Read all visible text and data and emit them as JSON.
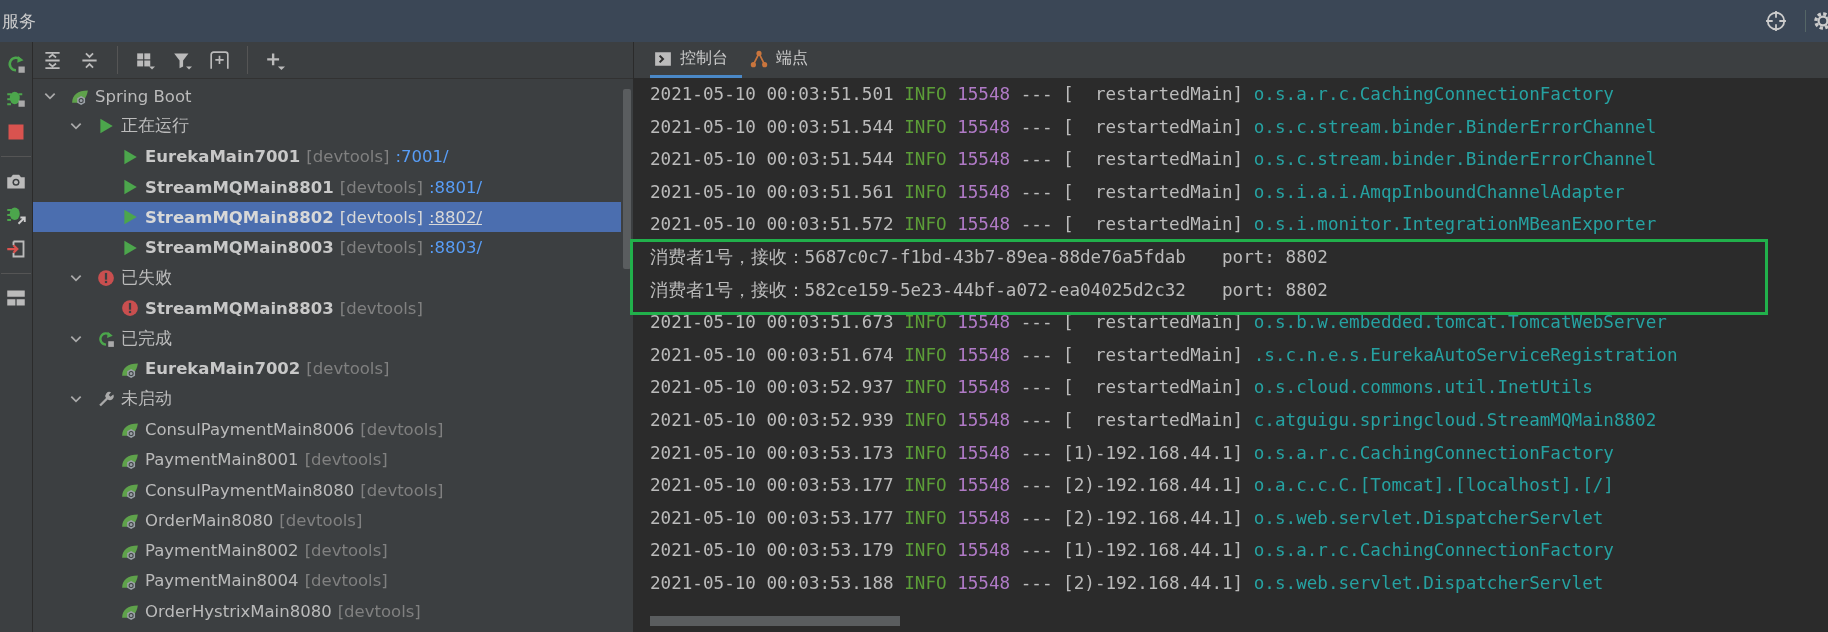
{
  "window": {
    "title": "服务"
  },
  "tree": [
    {
      "label": "Spring Boot",
      "kind": "spring",
      "expanded": true,
      "children": [
        {
          "label": "正在运行",
          "kind": "run",
          "expanded": true,
          "children": [
            {
              "label": "EurekaMain7001",
              "tag": "[devtools]",
              "port": ":7001/",
              "kind": "run",
              "active": true,
              "selected": false
            },
            {
              "label": "StreamMQMain8801",
              "tag": "[devtools]",
              "port": ":8801/",
              "kind": "run",
              "active": true,
              "selected": false
            },
            {
              "label": "StreamMQMain8802",
              "tag": "[devtools]",
              "port": ":8802/",
              "kind": "run",
              "active": true,
              "selected": true
            },
            {
              "label": "StreamMQMain8003",
              "tag": "[devtools]",
              "port": ":8803/",
              "kind": "run",
              "active": true,
              "selected": false
            }
          ]
        },
        {
          "label": "已失败",
          "kind": "error",
          "expanded": true,
          "children": [
            {
              "label": "StreamMQMain8803",
              "tag": "[devtools]",
              "kind": "error",
              "active": true,
              "selected": false
            }
          ]
        },
        {
          "label": "已完成",
          "kind": "rerun",
          "expanded": true,
          "children": [
            {
              "label": "EurekaMain7002",
              "tag": "[devtools]",
              "kind": "spring",
              "active": true,
              "selected": false
            }
          ]
        },
        {
          "label": "未启动",
          "kind": "wrench",
          "expanded": true,
          "children": [
            {
              "label": "ConsulPaymentMain8006",
              "tag": "[devtools]",
              "kind": "spring",
              "active": false,
              "selected": false
            },
            {
              "label": "PaymentMain8001",
              "tag": "[devtools]",
              "kind": "spring",
              "active": false,
              "selected": false
            },
            {
              "label": "ConsulPaymentMain8080",
              "tag": "[devtools]",
              "kind": "spring",
              "active": false,
              "selected": false
            },
            {
              "label": "OrderMain8080",
              "tag": "[devtools]",
              "kind": "spring",
              "active": false,
              "selected": false
            },
            {
              "label": "PaymentMain8002",
              "tag": "[devtools]",
              "kind": "spring",
              "active": false,
              "selected": false
            },
            {
              "label": "PaymentMain8004",
              "tag": "[devtools]",
              "kind": "spring",
              "active": false,
              "selected": false
            },
            {
              "label": "OrderHystrixMain8080",
              "tag": "[devtools]",
              "kind": "spring",
              "active": false,
              "selected": false
            }
          ]
        }
      ]
    }
  ],
  "tabs": [
    {
      "label": "控制台",
      "selected": true
    },
    {
      "label": "端点",
      "selected": false
    }
  ],
  "console": [
    {
      "kind": "log",
      "time": "2021-05-10 00:03:51.501",
      "level": "INFO",
      "pid": "15548",
      "sep": "---",
      "thread": "[  restartedMain]",
      "logger": "o.s.a.r.c.CachingConnectionFactory"
    },
    {
      "kind": "log",
      "time": "2021-05-10 00:03:51.544",
      "level": "INFO",
      "pid": "15548",
      "sep": "---",
      "thread": "[  restartedMain]",
      "logger": "o.s.c.stream.binder.BinderErrorChannel"
    },
    {
      "kind": "log",
      "time": "2021-05-10 00:03:51.544",
      "level": "INFO",
      "pid": "15548",
      "sep": "---",
      "thread": "[  restartedMain]",
      "logger": "o.s.c.stream.binder.BinderErrorChannel"
    },
    {
      "kind": "log",
      "time": "2021-05-10 00:03:51.561",
      "level": "INFO",
      "pid": "15548",
      "sep": "---",
      "thread": "[  restartedMain]",
      "logger": "o.s.i.a.i.AmqpInboundChannelAdapter"
    },
    {
      "kind": "log",
      "time": "2021-05-10 00:03:51.572",
      "level": "INFO",
      "pid": "15548",
      "sep": "---",
      "thread": "[  restartedMain]",
      "logger": "o.s.i.monitor.IntegrationMBeanExporter"
    },
    {
      "kind": "plain",
      "text": "消费者1号，接收：5687c0c7-f1bd-43b7-89ea-88de76a5fdab\tport: 8802"
    },
    {
      "kind": "plain",
      "text": "消费者1号，接收：582ce159-5e23-44bf-a072-ea04025d2c32\tport: 8802"
    },
    {
      "kind": "log",
      "time": "2021-05-10 00:03:51.673",
      "level": "INFO",
      "pid": "15548",
      "sep": "---",
      "thread": "[  restartedMain]",
      "logger": "o.s.b.w.embedded.tomcat.TomcatWebServer"
    },
    {
      "kind": "log",
      "time": "2021-05-10 00:03:51.674",
      "level": "INFO",
      "pid": "15548",
      "sep": "---",
      "thread": "[  restartedMain]",
      "logger": ".s.c.n.e.s.EurekaAutoServiceRegistration"
    },
    {
      "kind": "log",
      "time": "2021-05-10 00:03:52.937",
      "level": "INFO",
      "pid": "15548",
      "sep": "---",
      "thread": "[  restartedMain]",
      "logger": "o.s.cloud.commons.util.InetUtils"
    },
    {
      "kind": "log",
      "time": "2021-05-10 00:03:52.939",
      "level": "INFO",
      "pid": "15548",
      "sep": "---",
      "thread": "[  restartedMain]",
      "logger": "c.atguigu.springcloud.StreamMQMain8802"
    },
    {
      "kind": "log",
      "time": "2021-05-10 00:03:53.173",
      "level": "INFO",
      "pid": "15548",
      "sep": "---",
      "thread": "[1)-192.168.44.1]",
      "logger": "o.s.a.r.c.CachingConnectionFactory"
    },
    {
      "kind": "log",
      "time": "2021-05-10 00:03:53.177",
      "level": "INFO",
      "pid": "15548",
      "sep": "---",
      "thread": "[2)-192.168.44.1]",
      "logger": "o.a.c.c.C.[Tomcat].[localhost].[/]"
    },
    {
      "kind": "log",
      "time": "2021-05-10 00:03:53.177",
      "level": "INFO",
      "pid": "15548",
      "sep": "---",
      "thread": "[2)-192.168.44.1]",
      "logger": "o.s.web.servlet.DispatcherServlet"
    },
    {
      "kind": "log",
      "time": "2021-05-10 00:03:53.179",
      "level": "INFO",
      "pid": "15548",
      "sep": "---",
      "thread": "[1)-192.168.44.1]",
      "logger": "o.s.a.r.c.CachingConnectionFactory"
    },
    {
      "kind": "log",
      "time": "2021-05-10 00:03:53.188",
      "level": "INFO",
      "pid": "15548",
      "sep": "---",
      "thread": "[2)-192.168.44.1]",
      "logger": "o.s.web.servlet.DispatcherServlet"
    }
  ]
}
